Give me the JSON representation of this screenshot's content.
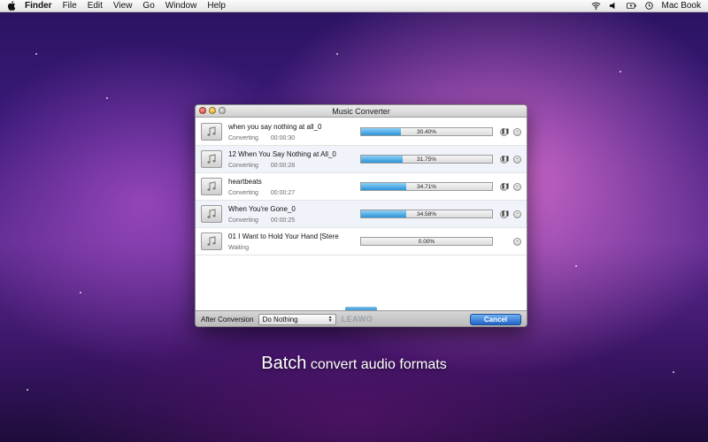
{
  "menubar": {
    "app": "Finder",
    "items": [
      "File",
      "Edit",
      "View",
      "Go",
      "Window",
      "Help"
    ],
    "status_icons": [
      "wifi-icon",
      "volume-icon",
      "battery-icon",
      "clock-icon"
    ],
    "user": "Mac Book"
  },
  "window": {
    "title": "Music Converter",
    "rows": [
      {
        "name": "when you say nothing at all_0",
        "status": "Converting",
        "time": "00:00:30",
        "progress": 30.4,
        "progress_label": "30.40%",
        "paused": true
      },
      {
        "name": "12 When You Say Nothing at All_0",
        "status": "Converting",
        "time": "00:00:28",
        "progress": 31.75,
        "progress_label": "31.75%",
        "paused": true
      },
      {
        "name": "heartbeats",
        "status": "Converting",
        "time": "00:00:27",
        "progress": 34.71,
        "progress_label": "34.71%",
        "paused": true
      },
      {
        "name": "When You're Gone_0",
        "status": "Converting",
        "time": "00:00:25",
        "progress": 34.58,
        "progress_label": "34.58%",
        "paused": true
      },
      {
        "name": "01 I Want to Hold Your Hand [Stere",
        "status": "Waiting",
        "time": "",
        "progress": 0,
        "progress_label": "0.00%",
        "paused": false
      }
    ],
    "after_conversion_label": "After Conversion",
    "after_conversion_value": "Do Nothing",
    "brand": "LEAWO",
    "cancel_label": "Cancel"
  },
  "caption": {
    "big": "Batch",
    "rest": " convert audio formats"
  },
  "colors": {
    "progress_fill": "#2a94d9",
    "cancel_button": "#2264c6"
  }
}
